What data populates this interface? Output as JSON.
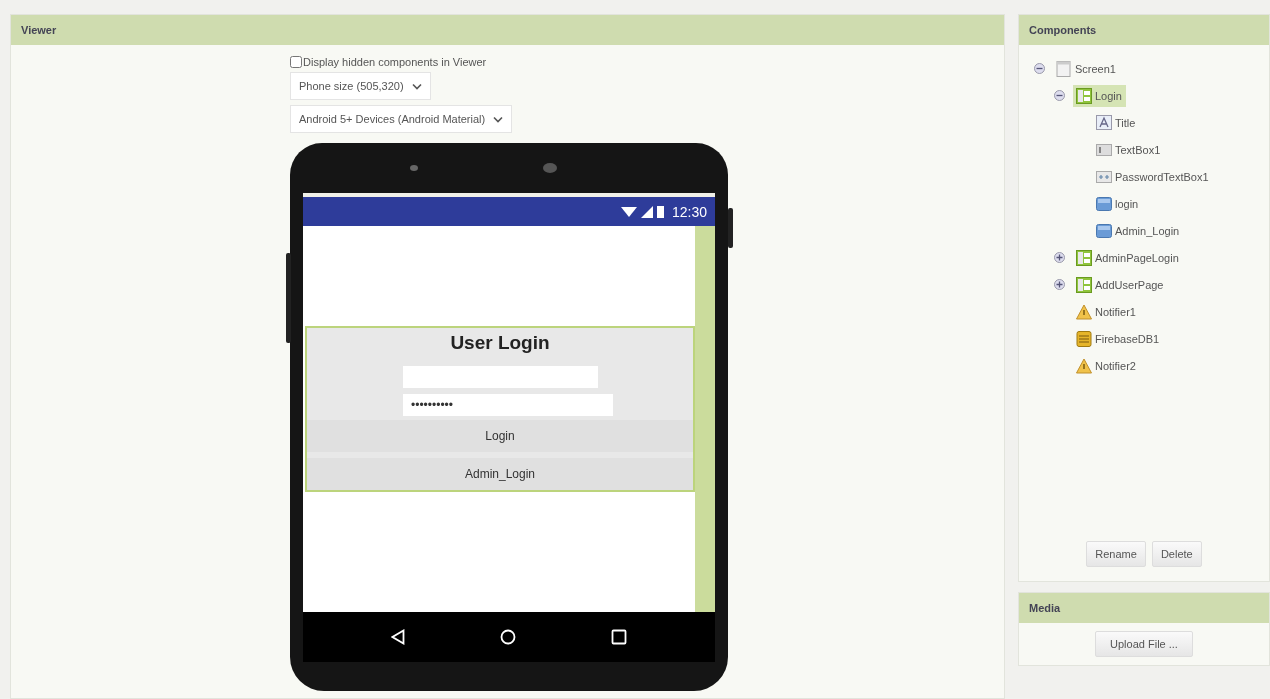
{
  "viewer": {
    "title": "Viewer",
    "hidden_components": {
      "label": "Display hidden components in Viewer",
      "checked": false
    },
    "size_select": {
      "value": "Phone size (505,320)"
    },
    "theme_select": {
      "value": "Android 5+ Devices (Android Material)"
    },
    "phone": {
      "status_time": "12:30",
      "arrangement": {
        "title": "User Login",
        "fields": [
          {
            "kind": "text"
          },
          {
            "kind": "password",
            "value": "••••••••••"
          }
        ],
        "buttons": [
          "Login",
          "Admin_Login"
        ]
      }
    }
  },
  "components": {
    "title": "Components",
    "tree": [
      {
        "kind": "screen",
        "label": "Screen1",
        "expanded": true,
        "selected": false,
        "children": [
          {
            "kind": "arrangement",
            "label": "Login",
            "expanded": true,
            "selected": true,
            "children": [
              {
                "kind": "label",
                "label": "Title",
                "selected": false
              },
              {
                "kind": "textbox",
                "label": "TextBox1",
                "selected": false
              },
              {
                "kind": "password",
                "label": "PasswordTextBox1",
                "selected": false
              },
              {
                "kind": "button",
                "label": "login",
                "selected": false
              },
              {
                "kind": "button",
                "label": "Admin_Login",
                "selected": false
              }
            ]
          },
          {
            "kind": "arrangement",
            "label": "AdminPageLogin",
            "expanded": false,
            "selected": false
          },
          {
            "kind": "arrangement",
            "label": "AddUserPage",
            "expanded": false,
            "selected": false
          },
          {
            "kind": "notifier",
            "label": "Notifier1",
            "selected": false
          },
          {
            "kind": "firebase",
            "label": "FirebaseDB1",
            "selected": false
          },
          {
            "kind": "notifier",
            "label": "Notifier2",
            "selected": false
          }
        ]
      }
    ],
    "buttons": [
      "Rename",
      "Delete"
    ]
  },
  "media": {
    "title": "Media",
    "button": "Upload File ..."
  }
}
